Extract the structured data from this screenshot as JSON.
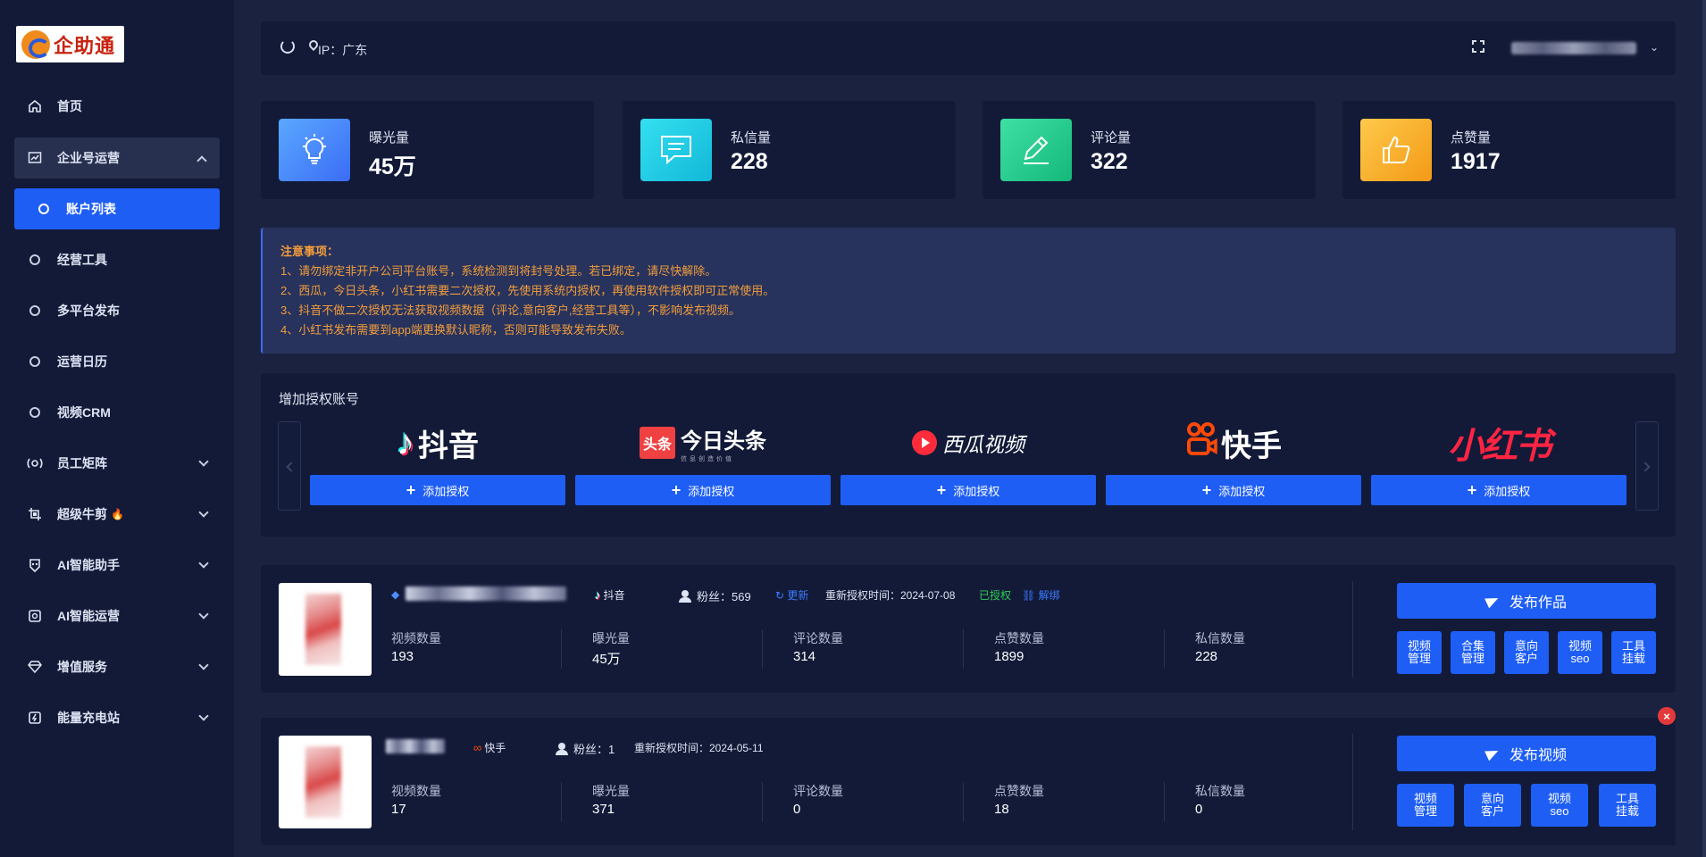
{
  "brand": {
    "name": "企助通"
  },
  "sidebar": {
    "items": [
      {
        "label": "首页",
        "icon": "home-icon"
      },
      {
        "label": "企业号运营",
        "icon": "chart-icon",
        "expanded": true
      },
      {
        "label": "账户列表",
        "icon": "circle-icon",
        "active": true
      },
      {
        "label": "经营工具",
        "icon": "circle-icon"
      },
      {
        "label": "多平台发布",
        "icon": "circle-icon"
      },
      {
        "label": "运营日历",
        "icon": "circle-icon"
      },
      {
        "label": "视频CRM",
        "icon": "circle-icon"
      },
      {
        "label": "员工矩阵",
        "icon": "radar-icon"
      },
      {
        "label": "超级牛剪",
        "icon": "crop-icon",
        "hot": true
      },
      {
        "label": "AI智能助手",
        "icon": "robot-icon"
      },
      {
        "label": "AI智能运营",
        "icon": "ai-icon"
      },
      {
        "label": "增值服务",
        "icon": "diamond-icon"
      },
      {
        "label": "能量充电站",
        "icon": "charge-icon"
      }
    ]
  },
  "topbar": {
    "ip_label": "IP：广东"
  },
  "stats": [
    {
      "label": "曝光量",
      "value": "45万",
      "color": "#3b7bf6",
      "icon": "lightbulb-icon"
    },
    {
      "label": "私信量",
      "value": "228",
      "color": "#1dc8e0",
      "icon": "message-icon"
    },
    {
      "label": "评论量",
      "value": "322",
      "color": "#20c98a",
      "icon": "pen-icon"
    },
    {
      "label": "点赞量",
      "value": "1917",
      "color": "#f6a821",
      "icon": "thumbs-up-icon"
    }
  ],
  "notice": {
    "title": "注意事项：",
    "lines": [
      "1、请勿绑定非开户公司平台账号，系统检测到将封号处理。若已绑定，请尽快解除。",
      "2、西瓜，今日头条，小红书需要二次授权，先使用系统内授权，再使用软件授权即可正常使用。",
      "3、抖音不做二次授权无法获取视频数据（评论,意向客户,经营工具等），不影响发布视频。",
      "4、小红书发布需要到app端更换默认昵称，否则可能导致发布失败。"
    ]
  },
  "auth": {
    "title": "增加授权账号",
    "add_label": "添加授权",
    "platforms": [
      {
        "name": "抖音"
      },
      {
        "name": "今日头条",
        "badge": "头条",
        "sub": "信息创造价值"
      },
      {
        "name": "西瓜视频"
      },
      {
        "name": "快手"
      },
      {
        "name": "小红书"
      }
    ]
  },
  "accounts": [
    {
      "platform": "抖音",
      "fans": "粉丝：569",
      "update": "更新",
      "reauth": "重新授权时间：2024-07-08",
      "status": "已授权",
      "unbind": "解绑",
      "metrics": [
        {
          "label": "视频数量",
          "value": "193"
        },
        {
          "label": "曝光量",
          "value": "45万"
        },
        {
          "label": "评论数量",
          "value": "314"
        },
        {
          "label": "点赞数量",
          "value": "1899"
        },
        {
          "label": "私信数量",
          "value": "228"
        }
      ],
      "publish": "发布作品",
      "tools": [
        "视频\n管理",
        "合集\n管理",
        "意向\n客户",
        "视频\nseo",
        "工具\n挂载"
      ]
    },
    {
      "platform": "快手",
      "fans": "粉丝：1",
      "reauth": "重新授权时间：2024-05-11",
      "metrics": [
        {
          "label": "视频数量",
          "value": "17"
        },
        {
          "label": "曝光量",
          "value": "371"
        },
        {
          "label": "评论数量",
          "value": "0"
        },
        {
          "label": "点赞数量",
          "value": "18"
        },
        {
          "label": "私信数量",
          "value": "0"
        }
      ],
      "publish": "发布视频",
      "tools": [
        "视频\n管理",
        "意向\n客户",
        "视频\nseo",
        "工具\n挂载"
      ]
    }
  ]
}
